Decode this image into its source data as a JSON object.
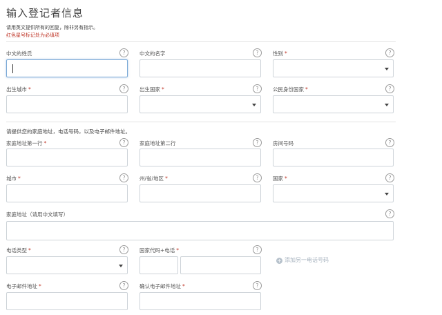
{
  "header": {
    "title": "输入登记者信息",
    "instruction": "请用英文提供所有的回复，除非另有指示。",
    "required_note": "红色星号标记处为必填项"
  },
  "fields": {
    "surname_cn": {
      "label": "中文的姓氏",
      "required": false
    },
    "given_name_cn": {
      "label": "中文的名字",
      "required": false
    },
    "gender": {
      "label": "性别",
      "required": true
    },
    "birth_city": {
      "label": "出生城市",
      "required": true
    },
    "birth_country": {
      "label": "出生国家",
      "required": true
    },
    "citizenship_country": {
      "label": "公民身份国家",
      "required": true
    },
    "address_line1": {
      "label": "家庭地址第一行",
      "required": true
    },
    "address_line2": {
      "label": "家庭地址第二行",
      "required": false
    },
    "room_number": {
      "label": "房间号码",
      "required": false
    },
    "city": {
      "label": "城市",
      "required": true
    },
    "state": {
      "label": "州/省/地区",
      "required": true
    },
    "country": {
      "label": "国家",
      "required": true
    },
    "address_cn": {
      "label": "家庭地址（请用中文填写）",
      "required": false
    },
    "phone_type": {
      "label": "电话类型",
      "required": true
    },
    "country_code_phone": {
      "label": "国家代码+电话",
      "required": true
    },
    "email": {
      "label": "电子邮件地址",
      "required": true
    },
    "email_confirm": {
      "label": "确认电子邮件地址",
      "required": true
    }
  },
  "contact_section": {
    "instruction": "请提供您的家庭地址，电话号码，以及电子邮件地址。"
  },
  "add_phone": {
    "label": "添加另一电话号码",
    "icon": "plus-circle-icon"
  },
  "help_symbol": "?",
  "required_marker": "*",
  "colors": {
    "required": "#c0392b",
    "border": "#cdd3d8",
    "focus": "#7aa9d6",
    "link_muted": "#a7b3bf"
  }
}
